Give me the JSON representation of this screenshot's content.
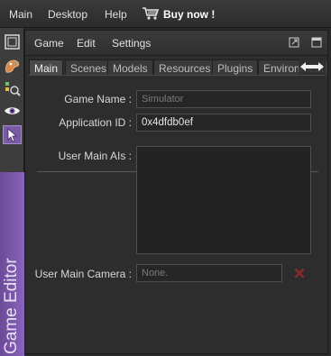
{
  "menubar": {
    "items": [
      "Main",
      "Desktop",
      "Help"
    ],
    "buy_now": "Buy now !"
  },
  "sidebar": {
    "buttons": [
      "window-icon",
      "palette-icon",
      "inspect-icon",
      "eye-icon",
      "cursor-icon"
    ],
    "vertical_label": "Game Editor"
  },
  "panel": {
    "menu": [
      "Game",
      "Edit",
      "Settings"
    ],
    "tabs": [
      "Main",
      "Scenes",
      "Models",
      "Resources",
      "Plugins",
      "Environment"
    ],
    "active_tab": "Main"
  },
  "form": {
    "game_name_label": "Game Name :",
    "game_name_placeholder": "Simulator",
    "app_id_label": "Application ID :",
    "app_id_value": "0x4dfdb0ef",
    "user_main_ais_label": "User Main AIs :",
    "user_main_camera_label": "User Main Camera :",
    "user_main_camera_placeholder": "None."
  },
  "colors": {
    "accent_purple": "#7a5aa5",
    "background": "#2d2d2d",
    "clear_x": "#8a2a2a"
  }
}
